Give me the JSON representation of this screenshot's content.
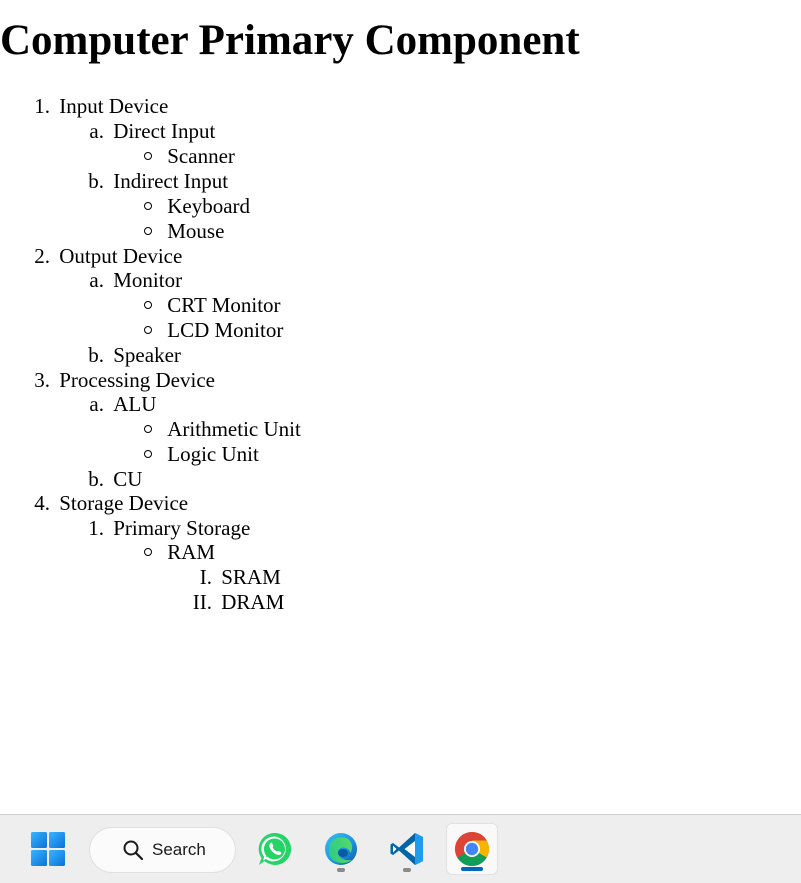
{
  "page": {
    "title": "Computer Primary Component",
    "items": [
      {
        "marker": "1.",
        "label": "Input Device"
      },
      {
        "marker": "a.",
        "label": "Direct Input"
      },
      {
        "marker": "",
        "label": "Scanner"
      },
      {
        "marker": "b.",
        "label": "Indirect Input"
      },
      {
        "marker": "",
        "label": "Keyboard"
      },
      {
        "marker": "",
        "label": "Mouse"
      },
      {
        "marker": "2.",
        "label": "Output Device"
      },
      {
        "marker": "a.",
        "label": "Monitor"
      },
      {
        "marker": "",
        "label": "CRT Monitor"
      },
      {
        "marker": "",
        "label": "LCD Monitor"
      },
      {
        "marker": "b.",
        "label": "Speaker"
      },
      {
        "marker": "3.",
        "label": "Processing Device"
      },
      {
        "marker": "a.",
        "label": "ALU"
      },
      {
        "marker": "",
        "label": "Arithmetic Unit"
      },
      {
        "marker": "",
        "label": "Logic Unit"
      },
      {
        "marker": "b.",
        "label": "CU"
      },
      {
        "marker": "4.",
        "label": "Storage Device"
      },
      {
        "marker": "1.",
        "label": "Primary Storage"
      },
      {
        "marker": "",
        "label": "RAM"
      },
      {
        "marker": "I.",
        "label": "SRAM"
      },
      {
        "marker": "II.",
        "label": "DRAM"
      }
    ]
  },
  "taskbar": {
    "search_label": "Search",
    "icons": [
      "windows-start-icon",
      "search-icon",
      "whatsapp-icon",
      "edge-icon",
      "vscode-icon",
      "chrome-icon"
    ],
    "colors": {
      "windows": "#1e90ff",
      "whatsapp": "#25d366",
      "edge": "#0c7bd8",
      "vscode": "#007acc",
      "active_indicator": "#0067c0"
    }
  }
}
